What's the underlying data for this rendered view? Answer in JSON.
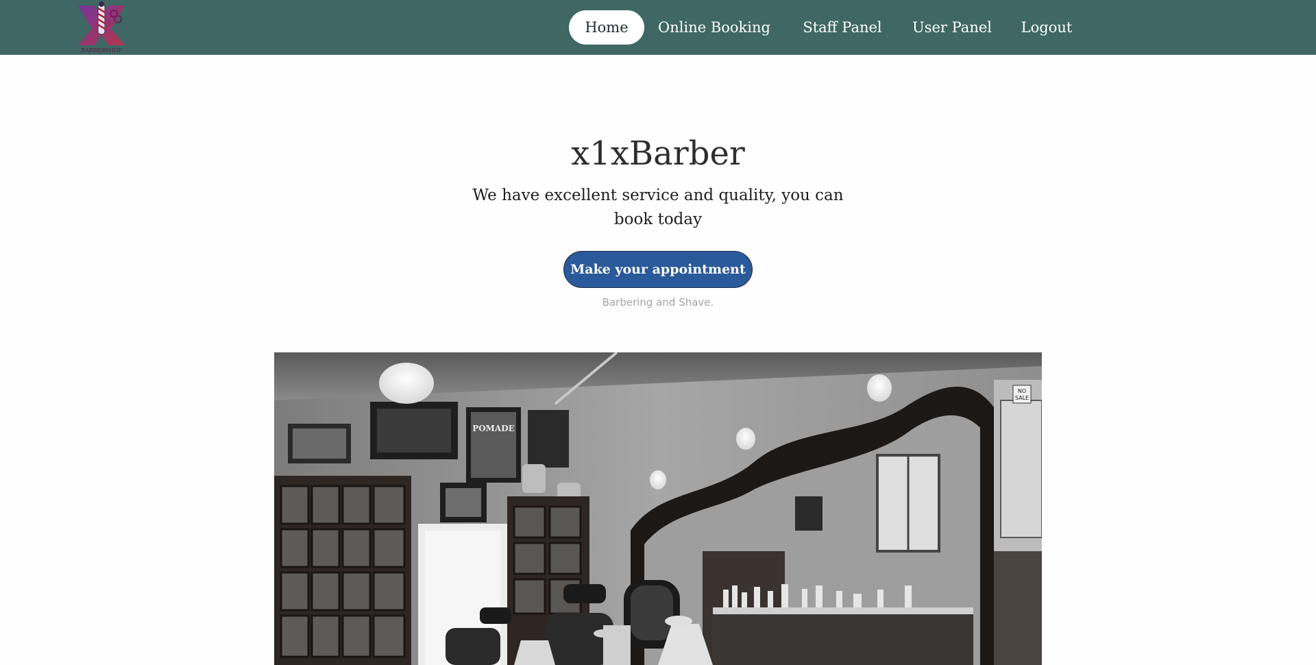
{
  "header": {
    "logo_icon": "barbershop-pole-logo",
    "logo_text": "BARBERSHOP",
    "nav": [
      {
        "label": "Home",
        "active": true
      },
      {
        "label": "Online Booking",
        "active": false
      },
      {
        "label": "Staff Panel",
        "active": false
      },
      {
        "label": "User Panel",
        "active": false
      },
      {
        "label": "Logout",
        "active": false
      }
    ]
  },
  "hero": {
    "title": "x1xBarber",
    "subtitle": "We have excellent service and quality, you can book today",
    "cta_label": "Make your appointment",
    "tagline": "Barbering and Shave."
  },
  "photo": {
    "signs": [
      "POMADE",
      "NO",
      "SALE"
    ],
    "style": "black-and-white barbershop interior"
  },
  "colors": {
    "header_bg": "#3f6864",
    "cta_bg": "#2b5a9a",
    "active_nav_bg": "#ffffff"
  }
}
